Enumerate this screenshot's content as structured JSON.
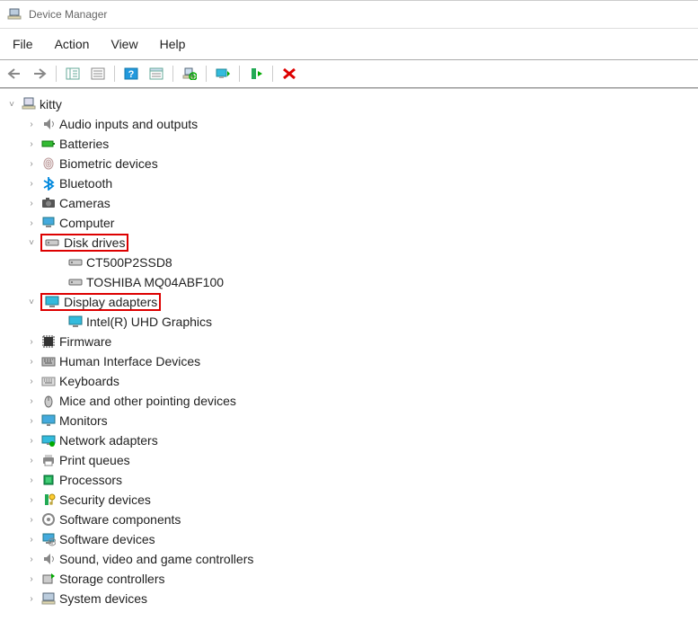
{
  "window": {
    "title": "Device Manager"
  },
  "menu": {
    "file": "File",
    "action": "Action",
    "view": "View",
    "help": "Help"
  },
  "toolbar": {
    "back": "back-icon",
    "forward": "forward-icon",
    "show_hide": "show-hide-tree-icon",
    "properties": "properties-icon",
    "help": "help-icon",
    "action_details": "details-icon",
    "scan": "scan-icon",
    "add_legacy": "add-legacy-icon",
    "update_driver": "update-driver-icon",
    "uninstall": "uninstall-icon"
  },
  "tree": {
    "root": {
      "label": "kitty",
      "expander": "expanded"
    },
    "nodes": [
      {
        "id": "audio",
        "label": "Audio inputs and outputs",
        "icon": "audio-icon",
        "expander": "collapsed"
      },
      {
        "id": "batteries",
        "label": "Batteries",
        "icon": "battery-icon",
        "expander": "collapsed"
      },
      {
        "id": "biometric",
        "label": "Biometric devices",
        "icon": "fingerprint-icon",
        "expander": "collapsed"
      },
      {
        "id": "bluetooth",
        "label": "Bluetooth",
        "icon": "bluetooth-icon",
        "expander": "collapsed"
      },
      {
        "id": "cameras",
        "label": "Cameras",
        "icon": "camera-icon",
        "expander": "collapsed"
      },
      {
        "id": "computer",
        "label": "Computer",
        "icon": "computer-icon",
        "expander": "collapsed"
      },
      {
        "id": "disk",
        "label": "Disk drives",
        "icon": "disk-icon",
        "expander": "expanded",
        "highlighted": true,
        "children": [
          {
            "id": "disk-0",
            "label": "CT500P2SSD8",
            "icon": "disk-icon"
          },
          {
            "id": "disk-1",
            "label": "TOSHIBA MQ04ABF100",
            "icon": "disk-icon"
          }
        ]
      },
      {
        "id": "display",
        "label": "Display adapters",
        "icon": "display-icon",
        "expander": "expanded",
        "highlighted": true,
        "children": [
          {
            "id": "display-0",
            "label": "Intel(R) UHD Graphics",
            "icon": "display-icon"
          }
        ]
      },
      {
        "id": "firmware",
        "label": "Firmware",
        "icon": "firmware-icon",
        "expander": "collapsed"
      },
      {
        "id": "hid",
        "label": "Human Interface Devices",
        "icon": "hid-icon",
        "expander": "collapsed"
      },
      {
        "id": "keyboards",
        "label": "Keyboards",
        "icon": "keyboard-icon",
        "expander": "collapsed"
      },
      {
        "id": "mice",
        "label": "Mice and other pointing devices",
        "icon": "mouse-icon",
        "expander": "collapsed"
      },
      {
        "id": "monitors",
        "label": "Monitors",
        "icon": "monitor-icon",
        "expander": "collapsed"
      },
      {
        "id": "network",
        "label": "Network adapters",
        "icon": "network-icon",
        "expander": "collapsed"
      },
      {
        "id": "print",
        "label": "Print queues",
        "icon": "printer-icon",
        "expander": "collapsed"
      },
      {
        "id": "processors",
        "label": "Processors",
        "icon": "cpu-icon",
        "expander": "collapsed"
      },
      {
        "id": "security",
        "label": "Security devices",
        "icon": "security-icon",
        "expander": "collapsed"
      },
      {
        "id": "swcomp",
        "label": "Software components",
        "icon": "sw-component-icon",
        "expander": "collapsed"
      },
      {
        "id": "swdev",
        "label": "Software devices",
        "icon": "sw-device-icon",
        "expander": "collapsed"
      },
      {
        "id": "sound",
        "label": "Sound, video and game controllers",
        "icon": "sound-icon",
        "expander": "collapsed"
      },
      {
        "id": "storage",
        "label": "Storage controllers",
        "icon": "storage-icon",
        "expander": "collapsed"
      },
      {
        "id": "system",
        "label": "System devices",
        "icon": "system-icon",
        "expander": "collapsed"
      }
    ]
  }
}
